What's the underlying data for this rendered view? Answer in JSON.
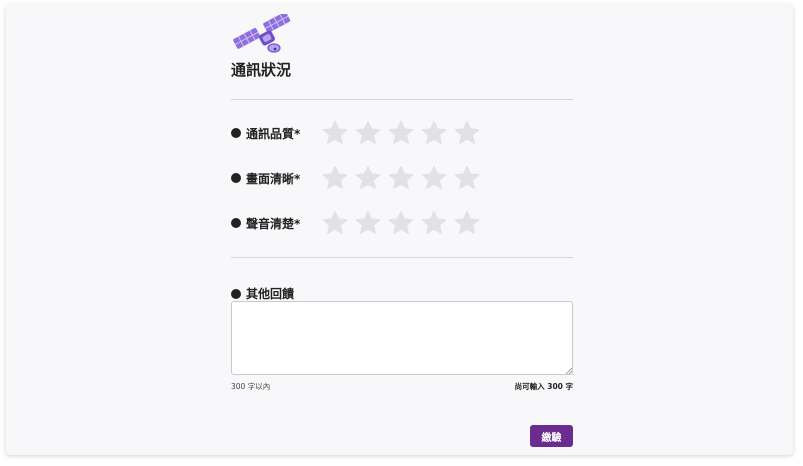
{
  "page": {
    "title": "通訊狀況"
  },
  "logo": {
    "icon": "satellite-icon",
    "colors": {
      "panel": "#8f6ee0",
      "panel_light": "#b9a3f0",
      "body": "#6f4fc8"
    }
  },
  "ratings": [
    {
      "label": "通訊品質*",
      "max": 5,
      "value": 0
    },
    {
      "label": "畫面清晰*",
      "max": 5,
      "value": 0
    },
    {
      "label": "聲音清楚*",
      "max": 5,
      "value": 0
    }
  ],
  "feedback": {
    "label": "其他回饋",
    "value": "",
    "limit_hint": "300 字以內",
    "remaining_hint": "尚可輸入 300 字"
  },
  "submit": {
    "label": "繳驗"
  },
  "colors": {
    "star_empty": "#e2e2e4",
    "accent": "#6a2c8e"
  }
}
